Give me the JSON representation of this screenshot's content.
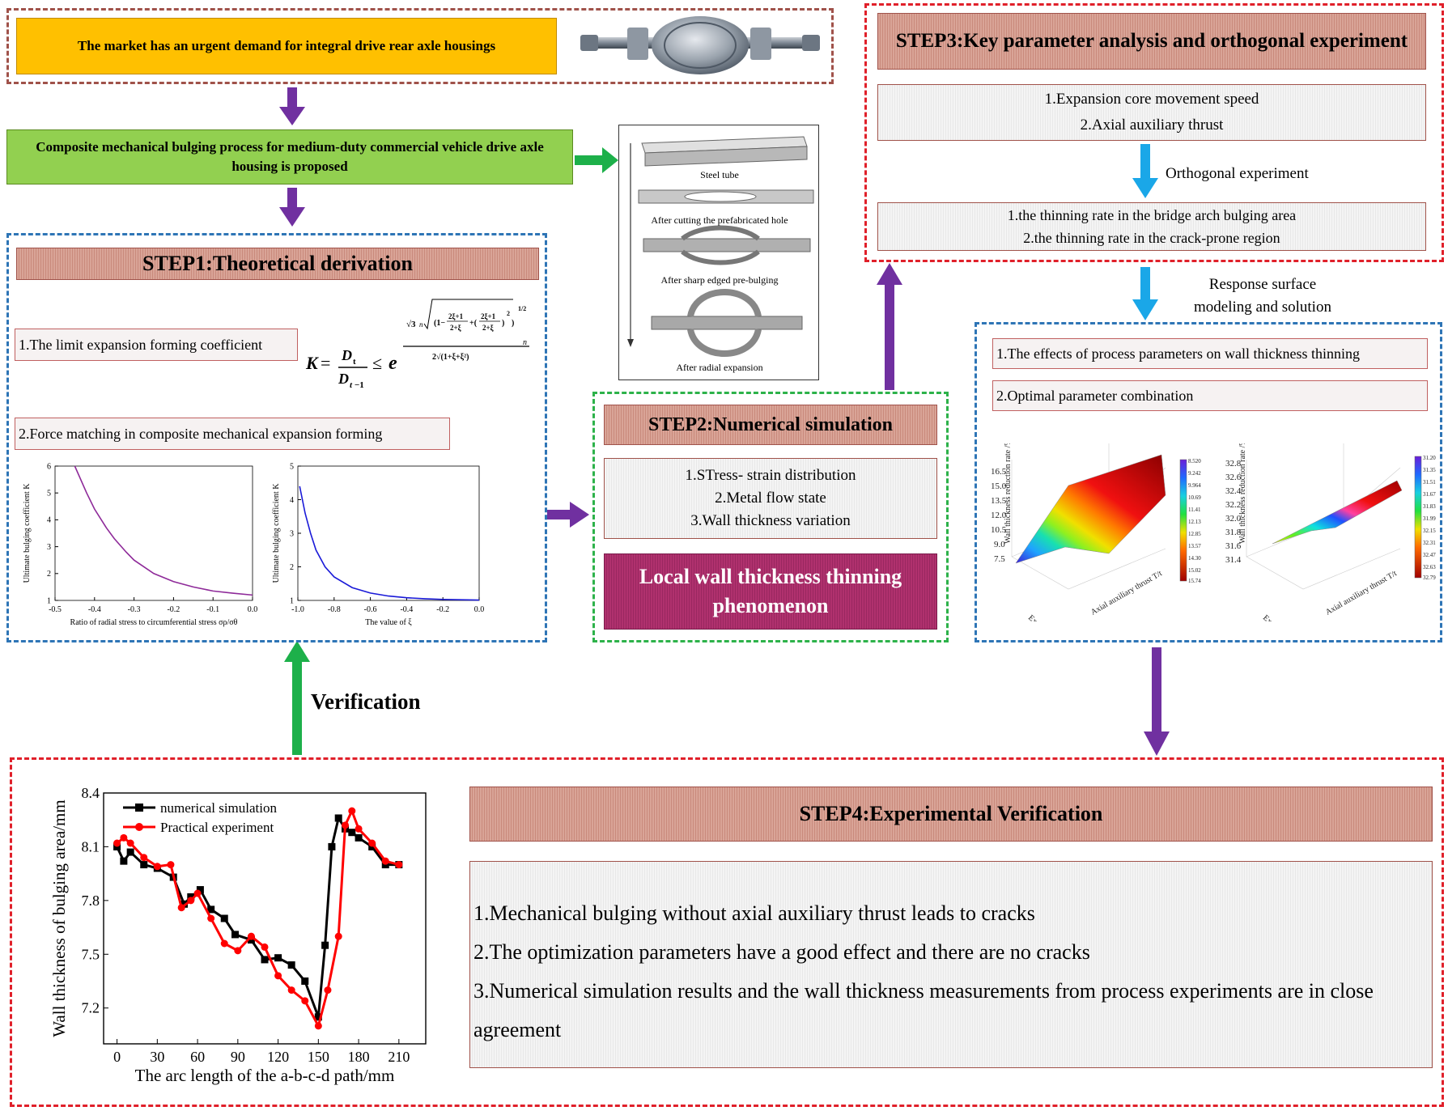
{
  "top": {
    "market_text": "The market has an urgent demand for integral drive rear axle housings",
    "proposal_text": "Composite mechanical bulging process for medium-duty commercial vehicle drive axle housing is proposed"
  },
  "process_image": {
    "steps": [
      "Steel tube",
      "After cutting the prefabricated hole",
      "After sharp edged pre-bulging",
      "After radial expansion"
    ]
  },
  "step1": {
    "title": "STEP1:Theoretical derivation",
    "item1": "1.The limit expansion forming coefficient",
    "item2": "2.Force matching in composite mechanical expansion forming",
    "formula": "K = D_t / D_{t-1} ≤ e^(...)",
    "chart1": {
      "ylabel": "Ultimate bulging coefficient K",
      "xlabel": "Ratio of radial stress to circumferential stress σρ/σθ"
    },
    "chart2": {
      "ylabel": "Ultimate bulging coefficient K",
      "xlabel": "The value of ξ"
    }
  },
  "step2": {
    "title": "STEP2:Numerical simulation",
    "item1": "1.STress- strain distribution",
    "item2": "2.Metal flow state",
    "item3": "3.Wall thickness variation",
    "phenomenon": "Local wall thickness thinning phenomenon"
  },
  "step3": {
    "title": "STEP3:Key parameter analysis and orthogonal experiment",
    "param1": "1.Expansion core movement speed",
    "param2": "2.Axial auxiliary thrust",
    "orthogonal_label": "Orthogonal experiment",
    "result1": "1.the thinning rate in the bridge arch bulging area",
    "result2": "2.the thinning rate in the crack-prone region",
    "response_label_1": "Response surface",
    "response_label_2": "modeling and solution"
  },
  "rs": {
    "item1": "1.The effects of process parameters on wall thickness thinning",
    "item2": "2.Optimal parameter combination",
    "plot1": {
      "zlabel": "Wall thickness reduction rate /%",
      "xlabel": "Expansion core speed v/(mm/s)",
      "ylabel": "Axial auxiliary thrust T/t",
      "zticks": [
        "16.5",
        "15.0",
        "13.5",
        "12.0",
        "10.5",
        "9.0",
        "7.5"
      ],
      "colorbar": [
        "8.520",
        "9.242",
        "9.964",
        "10.69",
        "11.41",
        "12.13",
        "12.85",
        "13.57",
        "14.30",
        "15.02",
        "15.74"
      ]
    },
    "plot2": {
      "zlabel": "Wall thickness reduction rate /%",
      "xlabel": "Expansion core speed v/(mm/s)",
      "ylabel": "Axial auxiliary thrust T/t",
      "zticks": [
        "32.8",
        "32.6",
        "32.4",
        "32.2",
        "32.0",
        "31.8",
        "31.6",
        "31.4"
      ],
      "colorbar": [
        "31.20",
        "31.35",
        "31.51",
        "31.67",
        "31.83",
        "31.99",
        "32.15",
        "32.31",
        "32.47",
        "32.63",
        "32.79"
      ]
    }
  },
  "verification_label": "Verification",
  "step4": {
    "title": "STEP4:Experimental Verification",
    "line1": "1.Mechanical bulging without axial auxiliary thrust leads to cracks",
    "line2": "2.The optimization parameters have a good effect and there are no cracks",
    "line3": "3.Numerical simulation results and the wall thickness measurements from process experiments are in close agreement"
  },
  "colors": {
    "purple_arrow": "#7030a0",
    "green_arrow": "#1db04a",
    "blue_arrow": "#1aa7e8",
    "market_box": "#ffc000",
    "proposal_box": "#92d050"
  },
  "chart_data": [
    {
      "type": "line",
      "xlabel": "Ratio of radial stress to circumferential stress σρ/σθ",
      "ylabel": "Ultimate bulging coefficient K",
      "xlim": [
        -0.5,
        0.0
      ],
      "ylim": [
        1,
        6
      ],
      "xticks": [
        "-0.5",
        "-0.4",
        "-0.3",
        "-0.2",
        "-0.1",
        "0.0"
      ],
      "yticks": [
        "1",
        "2",
        "3",
        "4",
        "5",
        "6"
      ],
      "color": "#8e2a99",
      "series": [
        {
          "x": [
            -0.45,
            -0.42,
            -0.4,
            -0.37,
            -0.35,
            -0.32,
            -0.3,
            -0.25,
            -0.2,
            -0.15,
            -0.1,
            -0.05,
            0.0
          ],
          "values": [
            6.0,
            5.0,
            4.4,
            3.7,
            3.3,
            2.8,
            2.5,
            2.0,
            1.7,
            1.5,
            1.35,
            1.27,
            1.2
          ]
        }
      ]
    },
    {
      "type": "line",
      "xlabel": "The value of ξ",
      "ylabel": "Ultimate bulging coefficient K",
      "xlim": [
        -1.0,
        0.0
      ],
      "ylim": [
        1,
        5
      ],
      "xticks": [
        "-1.0",
        "-0.8",
        "-0.6",
        "-0.4",
        "-0.2",
        "0.0"
      ],
      "yticks": [
        "1",
        "2",
        "3",
        "4",
        "5"
      ],
      "color": "#1a1ad8",
      "series": [
        {
          "x": [
            -0.99,
            -0.96,
            -0.93,
            -0.9,
            -0.85,
            -0.8,
            -0.7,
            -0.6,
            -0.5,
            -0.4,
            -0.3,
            -0.2,
            -0.1,
            0.0
          ],
          "values": [
            4.4,
            3.6,
            3.0,
            2.5,
            2.0,
            1.7,
            1.38,
            1.22,
            1.13,
            1.08,
            1.05,
            1.03,
            1.02,
            1.01
          ]
        }
      ]
    },
    {
      "type": "line",
      "xlabel": "The arc length of the a-b-c-d path/mm",
      "ylabel": "Wall thickness of bulging area/mm",
      "xlim": [
        -10,
        230
      ],
      "ylim": [
        7.0,
        8.4
      ],
      "xticks": [
        "0",
        "30",
        "60",
        "90",
        "120",
        "150",
        "180",
        "210"
      ],
      "yticks": [
        "7.2",
        "7.5",
        "7.8",
        "8.1",
        "8.4"
      ],
      "legend": "top-left",
      "series": [
        {
          "name": "numerical simulation",
          "color": "#000000",
          "marker": "square",
          "x": [
            0,
            5,
            10,
            20,
            30,
            42,
            50,
            55,
            62,
            70,
            80,
            88,
            100,
            110,
            120,
            130,
            140,
            150,
            155,
            160,
            165,
            170,
            175,
            180,
            190,
            200,
            210
          ],
          "values": [
            8.1,
            8.02,
            8.07,
            8.0,
            7.98,
            7.93,
            7.78,
            7.82,
            7.86,
            7.75,
            7.7,
            7.61,
            7.58,
            7.47,
            7.48,
            7.44,
            7.35,
            7.15,
            7.55,
            8.1,
            8.26,
            8.2,
            8.18,
            8.15,
            8.1,
            8.0,
            8.0
          ]
        },
        {
          "name": "Practical experiment",
          "color": "#ff0000",
          "marker": "circle",
          "x": [
            0,
            5,
            10,
            20,
            30,
            40,
            48,
            55,
            60,
            70,
            80,
            90,
            100,
            110,
            120,
            130,
            140,
            150,
            157,
            165,
            170,
            175,
            180,
            190,
            200,
            210
          ],
          "values": [
            8.12,
            8.15,
            8.12,
            8.04,
            7.99,
            8.0,
            7.76,
            7.8,
            7.84,
            7.7,
            7.56,
            7.52,
            7.6,
            7.54,
            7.38,
            7.3,
            7.24,
            7.1,
            7.3,
            7.6,
            8.22,
            8.3,
            8.2,
            8.12,
            8.02,
            8.0
          ]
        }
      ]
    }
  ]
}
